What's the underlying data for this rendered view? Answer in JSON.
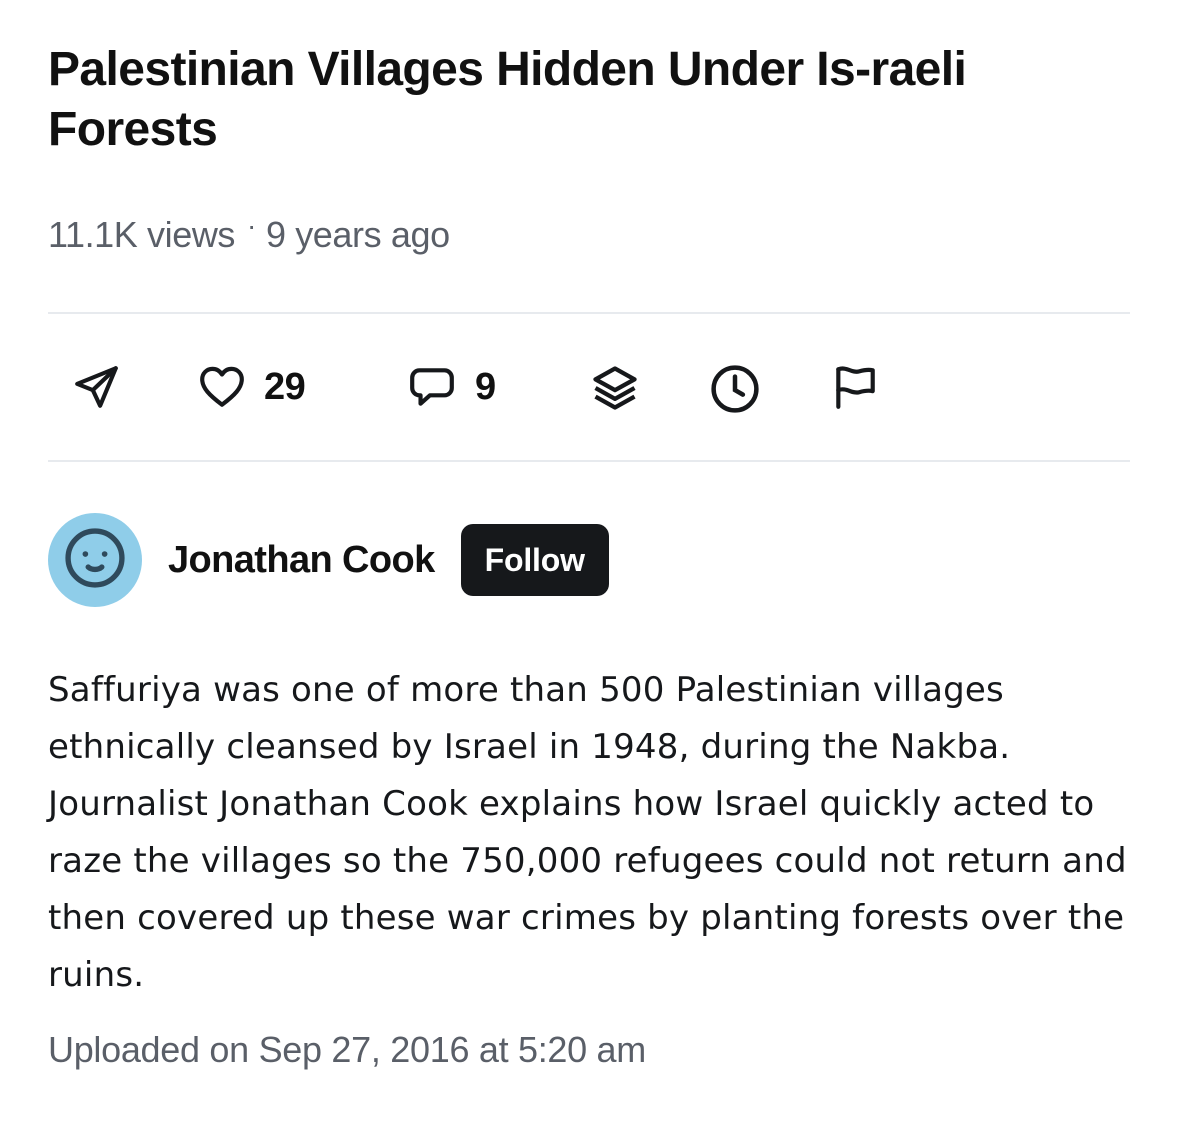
{
  "video": {
    "title": "Palestinian Villages Hidden Under Is-raeli Forests",
    "views": "11.1K views",
    "separator": "·",
    "age": "9 years ago"
  },
  "actions": [
    {
      "icon": "send-icon",
      "count": ""
    },
    {
      "icon": "heart-icon",
      "count": "29"
    },
    {
      "icon": "comment-icon",
      "count": "9"
    },
    {
      "icon": "layers-icon",
      "count": ""
    },
    {
      "icon": "clock-icon",
      "count": ""
    },
    {
      "icon": "flag-icon",
      "count": ""
    }
  ],
  "author": {
    "name": "Jonathan Cook",
    "follow_label": "Follow",
    "avatar_icon": "smiley-face-icon",
    "avatar_color": "#8fcde9"
  },
  "description": "Saffuriya was one of more than 500 Palestinian villages ethnically cleansed by Israel in 1948, during the Nakba. Journalist Jonathan Cook explains how Israel quickly acted to raze the villages so the 750,000 refugees could not return and then covered up these war crimes by planting forests over the ruins.",
  "uploaded": "Uploaded on Sep 27, 2016 at 5:20 am"
}
